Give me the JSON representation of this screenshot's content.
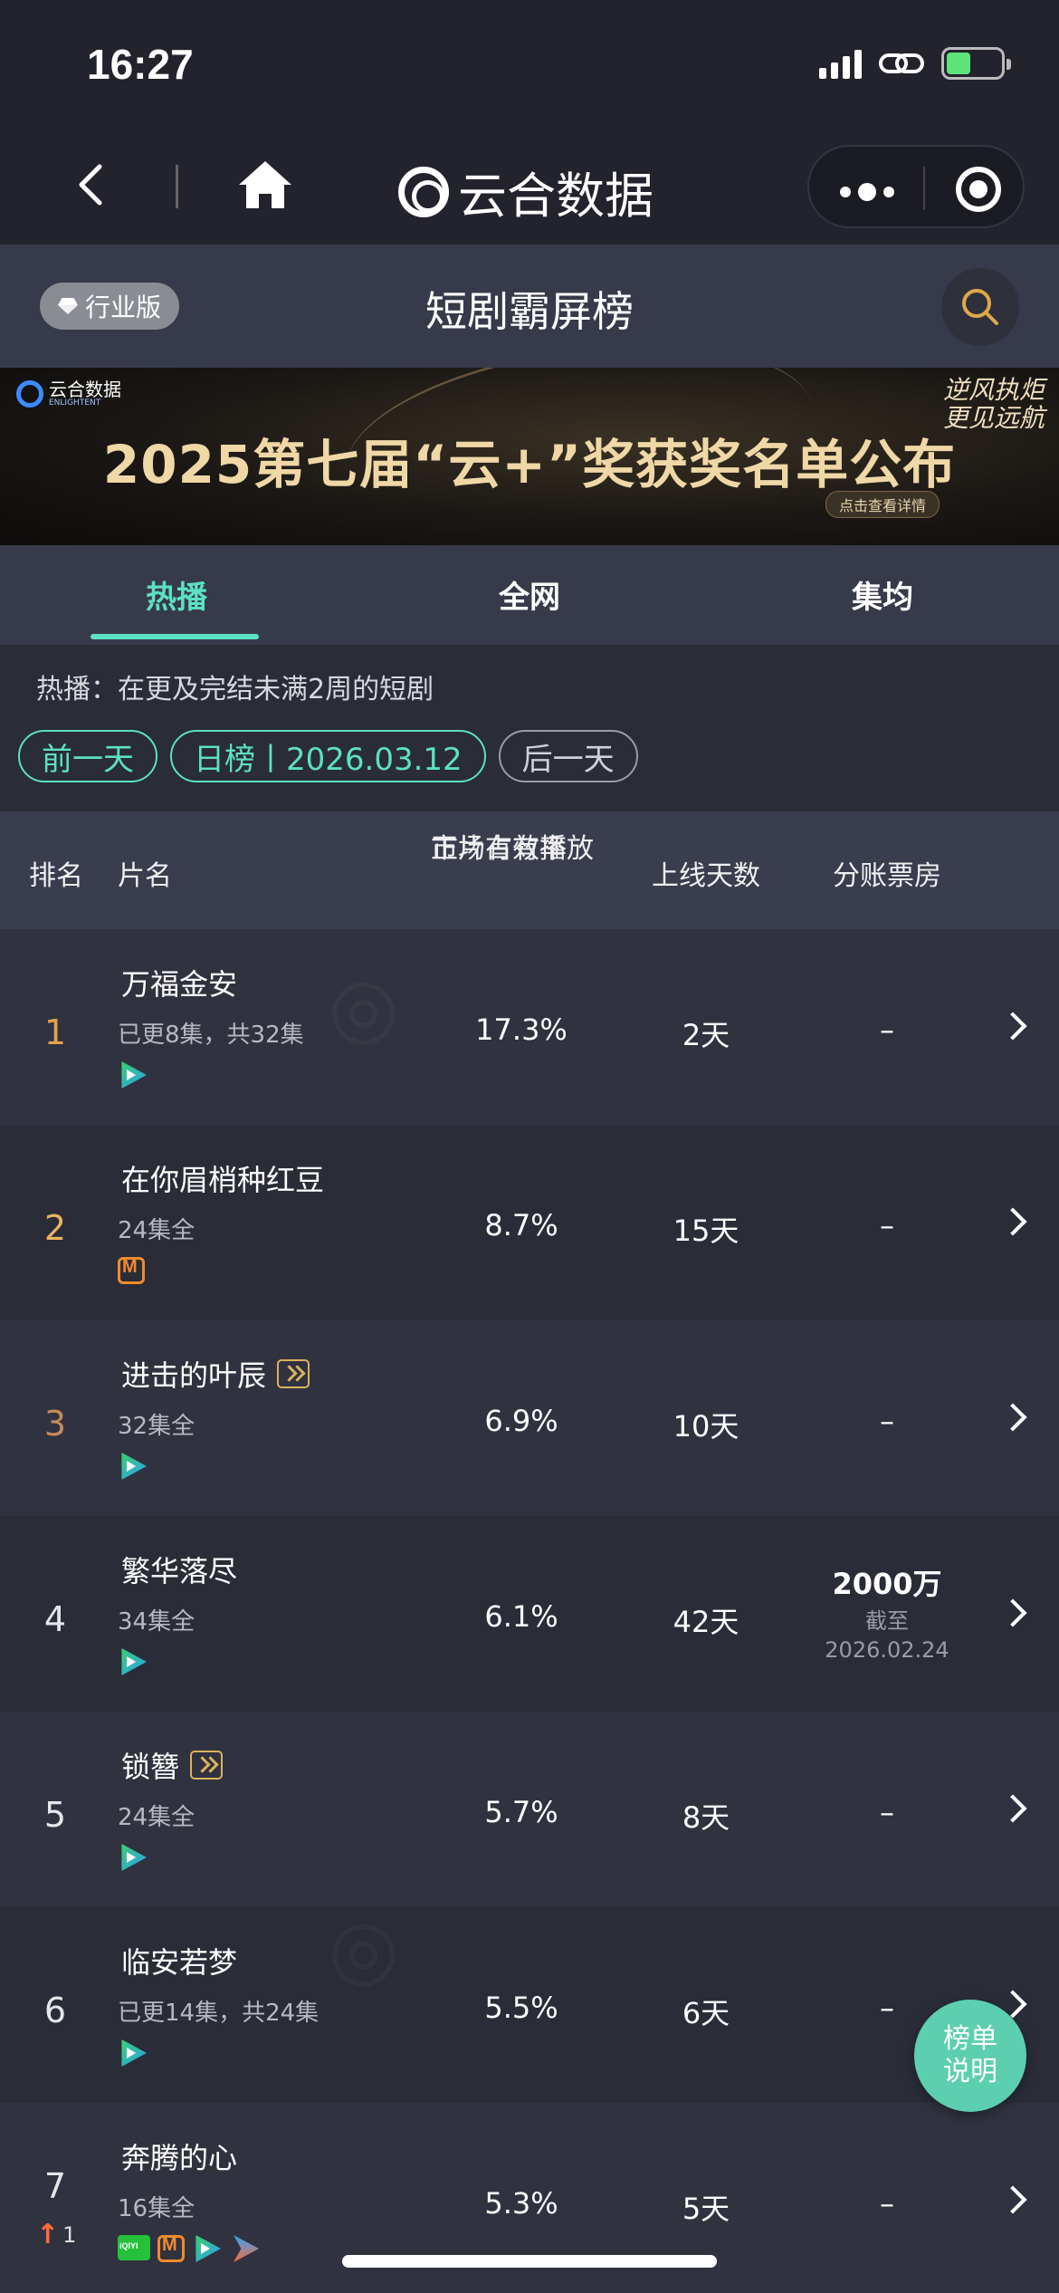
{
  "status_bar": {
    "time": "16:27"
  },
  "nav": {
    "brand": "云合数据"
  },
  "subheader": {
    "edition": "行业版",
    "title": "短剧霸屏榜"
  },
  "banner": {
    "logo_text": "云合数据",
    "logo_sub": "ENLIGHTENT",
    "headline": "2025第七届“云+”奖获奖名单公布",
    "slogan_line1": "逆风执炬",
    "slogan_line2": "更见远航",
    "cta": "点击查看详情"
  },
  "tabs": [
    {
      "label": "热播",
      "active": true
    },
    {
      "label": "全网",
      "active": false
    },
    {
      "label": "集均",
      "active": false
    }
  ],
  "description": "热播：在更及完结未满2周的短剧",
  "daynav": {
    "prev": "前一天",
    "current": "日榜丨2026.03.12",
    "next": "后一天"
  },
  "table": {
    "headers": {
      "rank": "排名",
      "name": "片名",
      "share_line1": "正片有效播放",
      "share_line2": "市场占有率",
      "days": "上线天数",
      "box": "分账票房"
    },
    "rows": [
      {
        "rank": "1",
        "title": "万福金安",
        "episodes": "已更8集，共32集",
        "platforms": [
          "tencent-icon"
        ],
        "share": "17.3%",
        "days": "2天",
        "box": "–"
      },
      {
        "rank": "2",
        "title": "在你眉梢种红豆",
        "episodes": "24集全",
        "platforms": [
          "mango-icon"
        ],
        "share": "8.7%",
        "days": "15天",
        "box": "–"
      },
      {
        "rank": "3",
        "title": "进击的叶辰",
        "exclusive": true,
        "episodes": "32集全",
        "platforms": [
          "tencent-icon"
        ],
        "share": "6.9%",
        "days": "10天",
        "box": "–"
      },
      {
        "rank": "4",
        "title": "繁华落尽",
        "episodes": "34集全",
        "platforms": [
          "tencent-icon"
        ],
        "share": "6.1%",
        "days": "42天",
        "box": "2000万",
        "box_note1": "截至",
        "box_note2": "2026.02.24"
      },
      {
        "rank": "5",
        "title": "锁簪",
        "exclusive": true,
        "episodes": "24集全",
        "platforms": [
          "tencent-icon"
        ],
        "share": "5.7%",
        "days": "8天",
        "box": "–"
      },
      {
        "rank": "6",
        "title": "临安若梦",
        "episodes": "已更14集，共24集",
        "platforms": [
          "tencent-icon"
        ],
        "share": "5.5%",
        "days": "6天",
        "box": "–"
      },
      {
        "rank": "7",
        "rank_change": "1",
        "title": "奔腾的心",
        "episodes": "16集全",
        "platforms": [
          "iqiyi-icon",
          "mango-icon",
          "tencent-icon",
          "youku-icon"
        ],
        "share": "5.3%",
        "days": "5天",
        "box": "–"
      }
    ]
  },
  "fab": {
    "line1": "榜单",
    "line2": "说明"
  },
  "colors": {
    "accent": "#5ce1c1",
    "background": "#2a2c38",
    "rank_top": "#e6a24b"
  }
}
